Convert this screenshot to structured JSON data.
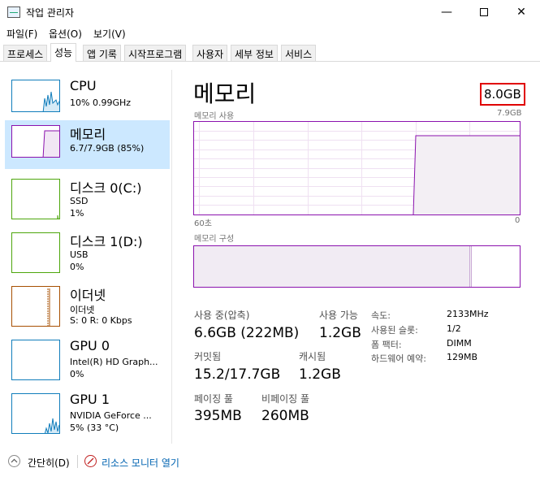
{
  "window": {
    "title": "작업 관리자",
    "minimize_glyph": "—",
    "close_glyph": "✕"
  },
  "menu": [
    "파일(F)",
    "옵션(O)",
    "보기(V)"
  ],
  "tabs": [
    "프로세스",
    "성능",
    "앱 기록",
    "시작프로그램",
    "사용자",
    "세부 정보",
    "서비스"
  ],
  "active_tab": "성능",
  "sidebar": {
    "cpu": {
      "name": "CPU",
      "sub1": "10% 0.99GHz"
    },
    "memory": {
      "name": "메모리",
      "sub1": "6.7/7.9GB (85%)"
    },
    "disk0": {
      "name": "디스크 0(C:)",
      "sub1": "SSD",
      "sub2": "1%"
    },
    "disk1": {
      "name": "디스크 1(D:)",
      "sub1": "USB",
      "sub2": "0%"
    },
    "ethernet": {
      "name": "이더넷",
      "sub1": "이더넷",
      "sub2": "S: 0 R: 0 Kbps"
    },
    "gpu0": {
      "name": "GPU 0",
      "sub1": "Intel(R) HD Graph...",
      "sub2": "0%"
    },
    "gpu1": {
      "name": "GPU 1",
      "sub1": "NVIDIA GeForce ...",
      "sub2": "5% (33 °C)"
    }
  },
  "memory_panel": {
    "title": "메모리",
    "total": "8.0GB",
    "usage_label": "메모리 사용",
    "usage_max": "7.9GB",
    "time_left": "60초",
    "time_right": "0",
    "composition_label": "메모리 구성",
    "usage_fraction": 0.85
  },
  "stats": {
    "in_use_label": "사용 중(압축)",
    "in_use_value": "6.6GB (222MB)",
    "available_label": "사용 가능",
    "available_value": "1.2GB",
    "committed_label": "커밋됨",
    "committed_value": "15.2/17.7GB",
    "cached_label": "캐시됨",
    "cached_value": "1.2GB",
    "paged_label": "페이징 풀",
    "paged_value": "395MB",
    "nonpaged_label": "비페이징 풀",
    "nonpaged_value": "260MB"
  },
  "details": {
    "speed_label": "속도:",
    "speed_value": "2133MHz",
    "slots_label": "사용된 슬롯:",
    "slots_value": "1/2",
    "form_label": "폼 팩터:",
    "form_value": "DIMM",
    "reserved_label": "하드웨어 예약:",
    "reserved_value": "129MB"
  },
  "footer": {
    "fewer_details": "간단히(D)",
    "resource_monitor": "리소스 모니터 열기"
  },
  "colors": {
    "memory_accent": "#8b12ae",
    "disk_accent": "#4da60c",
    "cpu_accent": "#117dbb",
    "ethernet_accent": "#a74f01",
    "selected_bg": "#cce8ff",
    "highlight_box": "#e00000"
  }
}
